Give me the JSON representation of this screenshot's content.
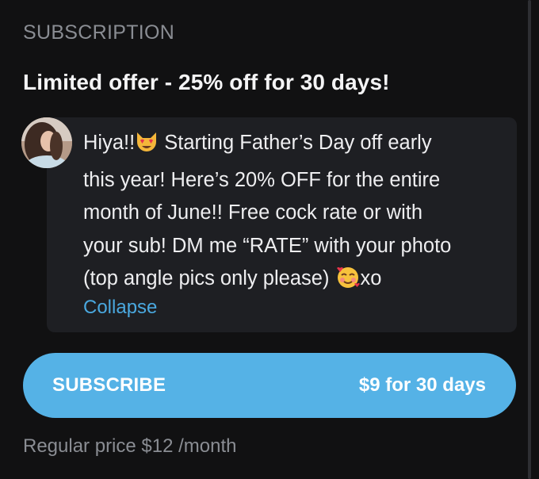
{
  "section": {
    "label": "SUBSCRIPTION"
  },
  "offer": {
    "title": "Limited offer - 25% off for 30 days!"
  },
  "message": {
    "line1_a": "Hiya!!",
    "line1_b": " Starting Father’s Day off early",
    "line2": "this year! Here’s 20% OFF for the entire",
    "line3": "month of June!! Free cock rate or with",
    "line4": "your sub! DM me “RATE” with your photo",
    "line5_a": "(top angle pics only please) ",
    "line5_b": "xo",
    "emoji_1": "heart-eyes-cat-icon",
    "emoji_2": "smiling-face-with-hearts-icon",
    "collapse_label": "Collapse"
  },
  "subscribe": {
    "label": "SUBSCRIBE",
    "price": "$9 for 30 days"
  },
  "regular": {
    "text": "Regular price $12 /month"
  },
  "colors": {
    "background": "#111112",
    "card": "#1e1f23",
    "accent": "#55b2e6",
    "link": "#4aa8df",
    "muted": "#8a8d93"
  }
}
